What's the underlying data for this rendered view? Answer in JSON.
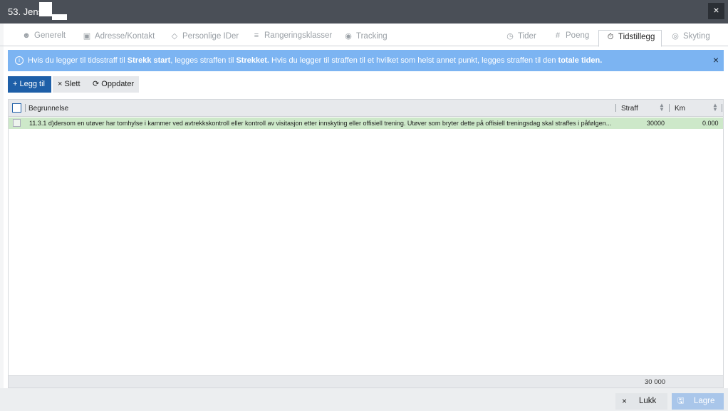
{
  "window": {
    "title": "53. Jens",
    "close_label": "×"
  },
  "tabs": [
    {
      "label": "Generelt",
      "icon": "user-icon"
    },
    {
      "label": "Adresse/Kontakt",
      "icon": "id-card-icon"
    },
    {
      "label": "Personlige IDer",
      "icon": "tag-icon"
    },
    {
      "label": "Rangeringsklasser",
      "icon": "layers-icon"
    },
    {
      "label": "Tracking",
      "icon": "tracking-icon"
    },
    {
      "label": "Tider",
      "icon": "clock-icon"
    },
    {
      "label": "Poeng",
      "icon": "hash-icon"
    },
    {
      "label": "Tidstillegg",
      "icon": "stopwatch-icon",
      "active": true
    },
    {
      "label": "Skyting",
      "icon": "target-icon"
    }
  ],
  "info": {
    "p1": "Hvis du legger til tidsstraff til ",
    "b1": "Strekk start",
    "p2": ", legges straffen til ",
    "b2": "Strekket.",
    "p3": " Hvis du legger til straffen til et hvilket som helst annet punkt, legges straffen til den ",
    "b3": "totale tiden.",
    "close": "×"
  },
  "toolbar": {
    "add": "Legg til",
    "delete": "Slett",
    "refresh": "Oppdater"
  },
  "grid": {
    "columns": {
      "reason": "Begrunnelse",
      "penalty": "Straff",
      "km": "Km"
    },
    "rows": [
      {
        "reason": "11.3.1 d)dersom en utøver har tomhylse i kammer ved avtrekkskontroll eller kontroll av visitasjon etter innskyting eller offisiell trening. Utøver som bryter dette på offisiell treningsdag skal straffes i påfølgen...",
        "penalty": "30000",
        "km": "0.000"
      }
    ],
    "total": "30 000"
  },
  "footer": {
    "close": "Lukk",
    "save": "Lagre"
  },
  "colors": {
    "titlebar": "#4a4f57",
    "info": "#7cb4f2",
    "primary": "#1e5fa8",
    "row_selected": "#cde8c9"
  }
}
